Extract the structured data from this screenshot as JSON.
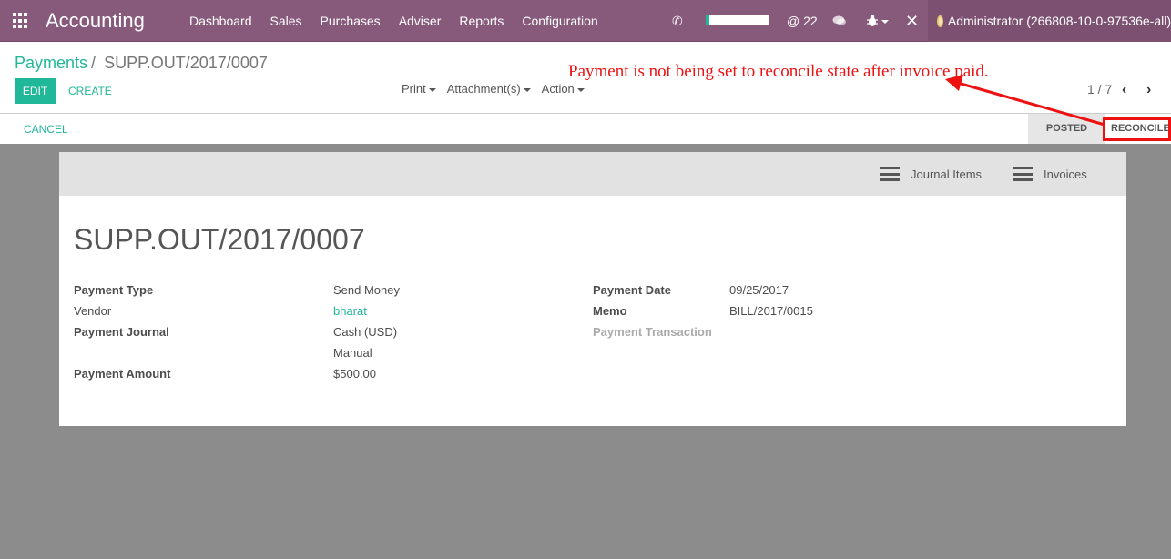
{
  "navbar": {
    "app_title": "Accounting",
    "menu": [
      "Dashboard",
      "Sales",
      "Purchases",
      "Adviser",
      "Reports",
      "Configuration"
    ],
    "mention_count": "@ 22",
    "user": "Administrator (266808-10-0-97536e-all)"
  },
  "control_panel": {
    "breadcrumb_parent": "Payments",
    "breadcrumb_separator": "/",
    "breadcrumb_current": "SUPP.OUT/2017/0007",
    "edit_label": "EDIT",
    "create_label": "CREATE",
    "print_label": "Print",
    "attachments_label": "Attachment(s)",
    "action_label": "Action",
    "pager": "1 / 7",
    "cancel_label": "CANCEL",
    "stages": [
      "POSTED",
      "RECONCILED"
    ]
  },
  "annotation": {
    "text": "Payment  is not  being set to reconcile state after invoice paid.",
    "color": "#ee1111"
  },
  "smart_buttons": {
    "journal_items": "Journal Items",
    "invoices": "Invoices"
  },
  "form": {
    "title": "SUPP.OUT/2017/0007",
    "payment_type_label": "Payment Type",
    "payment_type": "Send Money",
    "vendor_label": "Vendor",
    "vendor": "bharat",
    "journal_label": "Payment Journal",
    "journal": "Cash (USD)",
    "method": "Manual",
    "amount_label": "Payment Amount",
    "amount": "$500.00",
    "date_label": "Payment Date",
    "date": "09/25/2017",
    "memo_label": "Memo",
    "memo": "BILL/2017/0015",
    "transaction_label": "Payment Transaction"
  },
  "colors": {
    "brand": "#875a7b",
    "accent": "#21b799"
  }
}
